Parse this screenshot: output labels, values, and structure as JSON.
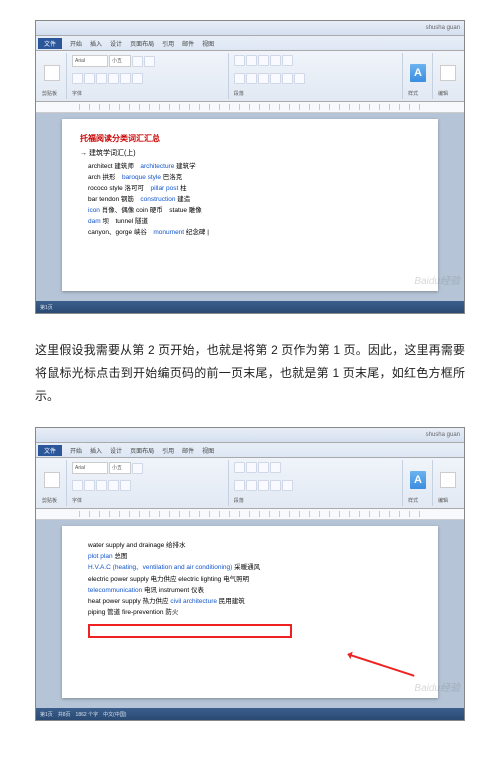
{
  "watermark": "Baidu经验",
  "window1": {
    "title_right": "shusha guan",
    "tabs": {
      "file": "文件",
      "t1": "开始",
      "t2": "插入",
      "t3": "设计",
      "t4": "页面布局",
      "t5": "引用",
      "t6": "邮件",
      "t7": "视图"
    },
    "font_name": "Arial",
    "font_size": "小五",
    "group_labels": {
      "clipboard": "剪贴板",
      "font": "字体",
      "para": "段落",
      "styles": "样式",
      "edit": "编辑"
    },
    "doc": {
      "title": "托福阅读分类词汇汇总",
      "subtitle": "建筑学词汇(上)",
      "lines": [
        {
          "pre": "architect 建筑师　",
          "kw": "architecture",
          "post": " 建筑学"
        },
        {
          "pre": "arch 拱形　",
          "kw": "baroque style",
          "post": " 巴洛克"
        },
        {
          "pre": "rococo style 洛可可　",
          "kw": "pillar post",
          "post": " 柱"
        },
        {
          "pre": "bar tendon 钢筋　",
          "kw": "construction",
          "post": " 建造"
        },
        {
          "pre": "",
          "kw": "icon",
          "post": " 肖像、偶像 coin 硬币　statue 雕像"
        },
        {
          "pre": "",
          "kw": "dam",
          "post": " 坝　tunnel 隧道"
        },
        {
          "pre": "canyon、gorge 峡谷　",
          "kw": "monument",
          "post": " 纪念碑 |"
        }
      ]
    },
    "status": "第1页"
  },
  "instruction_text": "这里假设我需要从第 2 页开始，也就是将第 2 页作为第 1 页。因此，这里再需要将鼠标光标点击到开始编页码的前一页末尾，也就是第 1 页末尾，如红色方框所示。",
  "window2": {
    "doc": {
      "lines": [
        {
          "pre": "water supply and drainage 给排水",
          "kw": "",
          "post": ""
        },
        {
          "pre": "",
          "kw": "plot plan",
          "post": " 总图"
        },
        {
          "pre": "",
          "kw": "H.V.A.C (heating、ventilation and air conditioning)",
          "post": " 采暖通风"
        },
        {
          "pre": "electric power supply 电力供应 electric lighting 电气照明",
          "kw": "",
          "post": ""
        },
        {
          "pre": "",
          "kw": "telecommunication",
          "post": " 电讯 instrument 仪表"
        },
        {
          "pre": "heat power supply 热力供应 ",
          "kw": "civil architecture",
          "post": " 民用建筑"
        },
        {
          "pre": "piping 管道 fire-prevention 防火",
          "kw": "",
          "post": ""
        }
      ]
    },
    "status": "第1页　共8页　1862 个字　中文(中国)"
  }
}
